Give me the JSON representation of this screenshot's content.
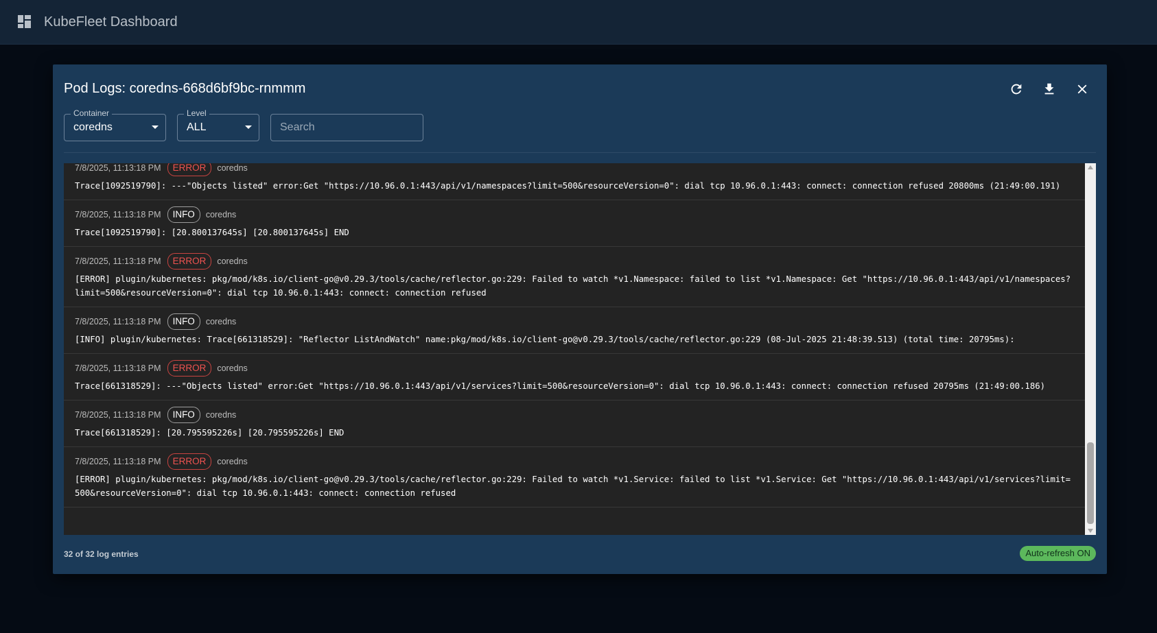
{
  "app": {
    "title": "KubeFleet Dashboard",
    "icon": "dashboard-grid-icon"
  },
  "dialog": {
    "title": "Pod Logs: coredns-668d6bf9bc-rnmmm",
    "actions": {
      "refresh_icon": "refresh-icon",
      "download_icon": "download-icon",
      "close_icon": "close-icon"
    }
  },
  "filters": {
    "container": {
      "label": "Container",
      "value": "coredns"
    },
    "level": {
      "label": "Level",
      "value": "ALL"
    },
    "search": {
      "placeholder": "Search",
      "value": ""
    }
  },
  "logs": [
    {
      "ts": "7/8/2025, 11:13:18 PM",
      "level": "ERROR",
      "container": "coredns",
      "message": "Trace[1092519790]: ---\"Objects listed\" error:Get \"https://10.96.0.1:443/api/v1/namespaces?limit=500&resourceVersion=0\": dial tcp 10.96.0.1:443: connect: connection refused 20800ms (21:49:00.191)"
    },
    {
      "ts": "7/8/2025, 11:13:18 PM",
      "level": "INFO",
      "container": "coredns",
      "message": "Trace[1092519790]: [20.800137645s] [20.800137645s] END"
    },
    {
      "ts": "7/8/2025, 11:13:18 PM",
      "level": "ERROR",
      "container": "coredns",
      "message": "[ERROR] plugin/kubernetes: pkg/mod/k8s.io/client-go@v0.29.3/tools/cache/reflector.go:229: Failed to watch *v1.Namespace: failed to list *v1.Namespace: Get \"https://10.96.0.1:443/api/v1/namespaces?limit=500&resourceVersion=0\": dial tcp 10.96.0.1:443: connect: connection refused"
    },
    {
      "ts": "7/8/2025, 11:13:18 PM",
      "level": "INFO",
      "container": "coredns",
      "message": "[INFO] plugin/kubernetes: Trace[661318529]: \"Reflector ListAndWatch\" name:pkg/mod/k8s.io/client-go@v0.29.3/tools/cache/reflector.go:229 (08-Jul-2025 21:48:39.513) (total time: 20795ms):"
    },
    {
      "ts": "7/8/2025, 11:13:18 PM",
      "level": "ERROR",
      "container": "coredns",
      "message": "Trace[661318529]: ---\"Objects listed\" error:Get \"https://10.96.0.1:443/api/v1/services?limit=500&resourceVersion=0\": dial tcp 10.96.0.1:443: connect: connection refused 20795ms (21:49:00.186)"
    },
    {
      "ts": "7/8/2025, 11:13:18 PM",
      "level": "INFO",
      "container": "coredns",
      "message": "Trace[661318529]: [20.795595226s] [20.795595226s] END"
    },
    {
      "ts": "7/8/2025, 11:13:18 PM",
      "level": "ERROR",
      "container": "coredns",
      "message": "[ERROR] plugin/kubernetes: pkg/mod/k8s.io/client-go@v0.29.3/tools/cache/reflector.go:229: Failed to watch *v1.Service: failed to list *v1.Service: Get \"https://10.96.0.1:443/api/v1/services?limit=500&resourceVersion=0\": dial tcp 10.96.0.1:443: connect: connection refused"
    }
  ],
  "footer": {
    "count": "32 of 32 log entries",
    "auto_refresh": "Auto-refresh ON"
  },
  "colors": {
    "error": "#ef5350",
    "auto_refresh": "#5cb85c",
    "dialog_bg": "#1b3a58"
  }
}
